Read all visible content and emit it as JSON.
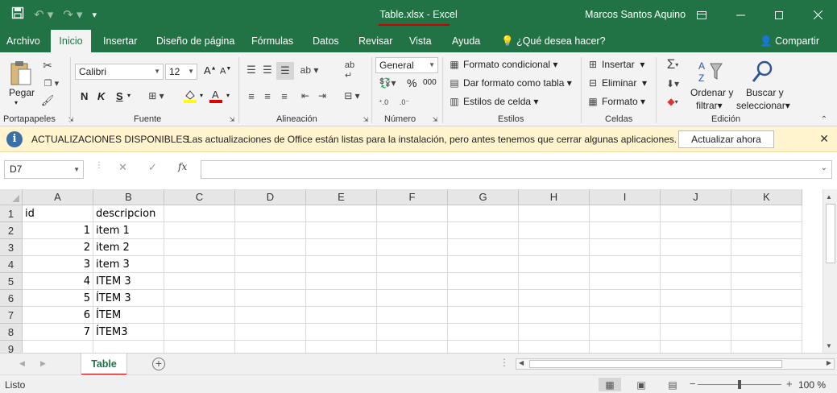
{
  "titlebar": {
    "doc_title": "Table.xlsx  -  Excel",
    "user": "Marcos Santos Aquino"
  },
  "tabs": {
    "items": [
      "Archivo",
      "Inicio",
      "Insertar",
      "Diseño de página",
      "Fórmulas",
      "Datos",
      "Revisar",
      "Vista",
      "Ayuda"
    ],
    "active": "Inicio",
    "tell_me": "¿Qué desea hacer?",
    "share": "Compartir"
  },
  "ribbon": {
    "clipboard": {
      "paste": "Pegar",
      "label": "Portapapeles"
    },
    "font": {
      "name": "Calibri",
      "size": "12",
      "bold": "N",
      "italic": "K",
      "underline": "S",
      "label": "Fuente"
    },
    "alignment": {
      "label": "Alineación"
    },
    "number": {
      "format": "General",
      "percent": "%",
      "thousands": "000",
      "label": "Número"
    },
    "styles": {
      "conditional": "Formato condicional",
      "as_table": "Dar formato como tabla",
      "cell_styles": "Estilos de celda",
      "label": "Estilos"
    },
    "cells": {
      "insert": "Insertar",
      "delete": "Eliminar",
      "format": "Formato",
      "label": "Celdas"
    },
    "editing": {
      "sort_1": "Ordenar y",
      "sort_2": "filtrar",
      "find_1": "Buscar y",
      "find_2": "seleccionar",
      "label": "Edición"
    }
  },
  "infobar": {
    "title": "ACTUALIZACIONES DISPONIBLES",
    "message": "Las actualizaciones de Office están listas para la instalación, pero antes tenemos que cerrar algunas aplicaciones.",
    "button": "Actualizar ahora"
  },
  "formula_bar": {
    "name_box": "D7",
    "fx": "fx",
    "content": ""
  },
  "sheet": {
    "columns": [
      "A",
      "B",
      "C",
      "D",
      "E",
      "F",
      "G",
      "H",
      "I",
      "J",
      "K"
    ],
    "rows": [
      [
        "1",
        "id",
        "descripcion"
      ],
      [
        "2",
        "1",
        "item 1"
      ],
      [
        "3",
        "2",
        "item 2"
      ],
      [
        "4",
        "3",
        "item 3"
      ],
      [
        "5",
        "4",
        "ITEM 3"
      ],
      [
        "6",
        "5",
        "ÍTEM 3"
      ],
      [
        "7",
        "6",
        "ÍTEM"
      ],
      [
        "8",
        "7",
        "ÍTEM3"
      ],
      [
        "9",
        "",
        ""
      ]
    ],
    "selected_cell": "D7"
  },
  "sheet_tabs": {
    "active": "Table"
  },
  "status": {
    "mode": "Listo",
    "zoom": "100 %",
    "zoom_value": 100
  }
}
